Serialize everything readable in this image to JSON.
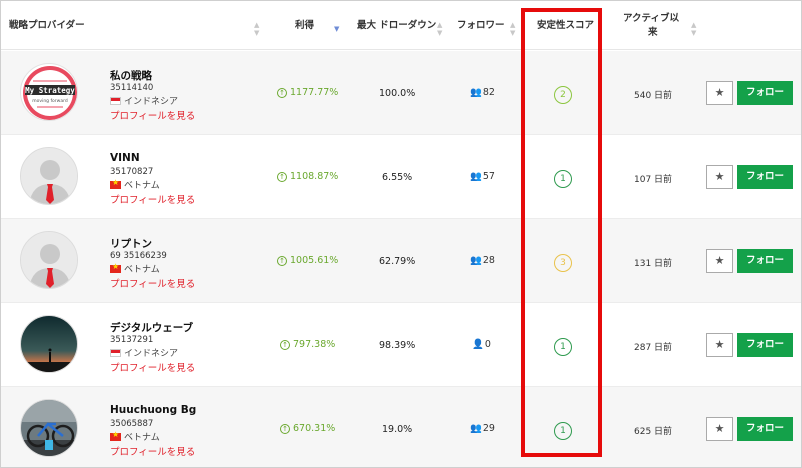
{
  "header": {
    "provider": "戦略プロバイダー",
    "profit": "利得",
    "drawdown": "最大 ドローダウン",
    "followers": "フォロワー",
    "stability": "安定性スコア",
    "active_line1": "アクティブ以",
    "active_line2": "来"
  },
  "colors": {
    "follow_button": "#14a14a",
    "profile_link": "#e0202a",
    "profit_green": "#6aa82e",
    "highlight": "#e60b0b",
    "score_1": "#2e9a4e",
    "score_2": "#8cc63f",
    "score_3": "#e9c24a"
  },
  "strategies": [
    {
      "name": "私の戦略",
      "account": "35114140",
      "country": "インドネシア",
      "flag": "indonesia-flag",
      "avatar": "my-strategy-logo",
      "avatar_text_1": "My Strategy",
      "avatar_text_2": "moving forward",
      "profile_link": "プロフィールを見る",
      "profit": "1177.77%",
      "drawdown": "100.0%",
      "followers": "82",
      "stability": "2",
      "active": "540 日前",
      "follow_label": "フォロー"
    },
    {
      "name": "VINN",
      "account": "35170827",
      "country": "ベトナム",
      "flag": "vietnam-flag",
      "avatar": "default-user-avatar",
      "profile_link": "プロフィールを見る",
      "profit": "1108.87%",
      "drawdown": "6.55%",
      "followers": "57",
      "stability": "1",
      "active": "107 日前",
      "follow_label": "フォロー"
    },
    {
      "name": "リプトン",
      "account": "69 35166239",
      "country": "ベトナム",
      "flag": "vietnam-flag",
      "avatar": "default-user-avatar",
      "profile_link": "プロフィールを見る",
      "profit": "1005.61%",
      "drawdown": "62.79%",
      "followers": "28",
      "stability": "3",
      "active": "131 日前",
      "follow_label": "フォロー"
    },
    {
      "name": "デジタルウェーブ",
      "account": "35137291",
      "country": "インドネシア",
      "flag": "indonesia-flag",
      "avatar": "night-landscape-photo",
      "profile_link": "プロフィールを見る",
      "profit": "797.38%",
      "drawdown": "98.39%",
      "followers": "0",
      "stability": "1",
      "active": "287 日前",
      "follow_label": "フォロー"
    },
    {
      "name": "Huuchuong Bg",
      "account": "35065887",
      "country": "ベトナム",
      "flag": "vietnam-flag",
      "avatar": "bicycle-photo",
      "profile_link": "プロフィールを見る",
      "profit": "670.31%",
      "drawdown": "19.0%",
      "followers": "29",
      "stability": "1",
      "active": "625 日前",
      "follow_label": "フォロー"
    }
  ]
}
